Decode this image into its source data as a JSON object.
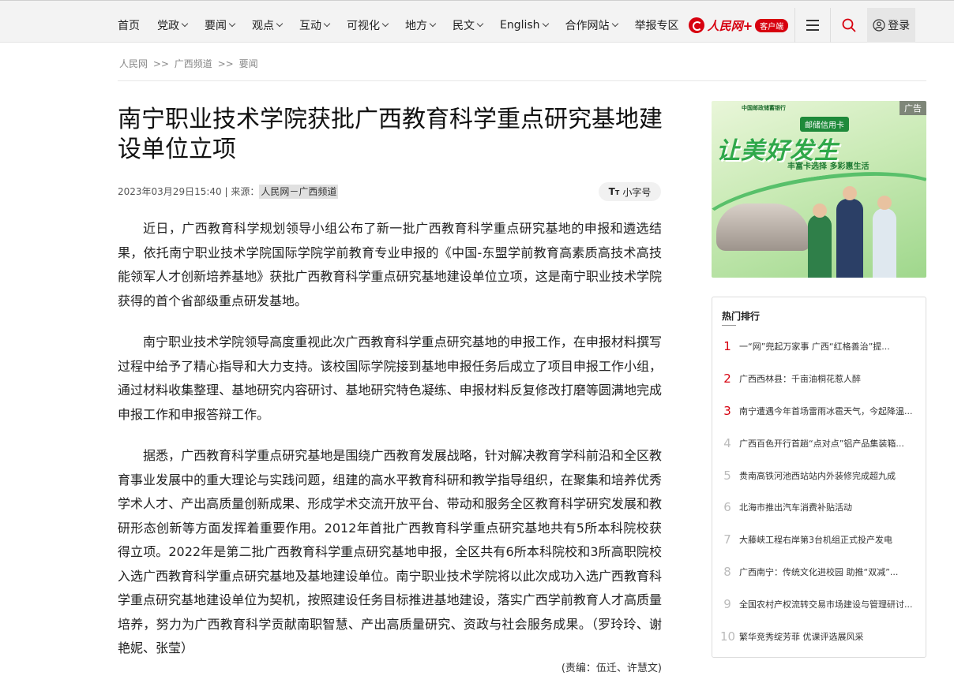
{
  "nav": {
    "items": [
      {
        "label": "首页",
        "dropdown": false
      },
      {
        "label": "党政",
        "dropdown": true
      },
      {
        "label": "要闻",
        "dropdown": true
      },
      {
        "label": "观点",
        "dropdown": true
      },
      {
        "label": "互动",
        "dropdown": true
      },
      {
        "label": "可视化",
        "dropdown": true
      },
      {
        "label": "地方",
        "dropdown": true
      },
      {
        "label": "民文",
        "dropdown": true
      },
      {
        "label": "English",
        "dropdown": true
      },
      {
        "label": "合作网站",
        "dropdown": true
      },
      {
        "label": "举报专区",
        "dropdown": false
      }
    ],
    "logo_text": "人民网+",
    "logo_badge": "客户端",
    "login_label": "登录"
  },
  "breadcrumb": {
    "items": [
      "人民网",
      "广西频道",
      "要闻"
    ],
    "separator": ">>"
  },
  "article": {
    "title": "南宁职业技术学院获批广西教育科学重点研究基地建设单位立项",
    "date": "2023年03月29日15:40",
    "source_prefix": " | 来源：",
    "source": "人民网－广西频道",
    "font_size_label": "小字号",
    "paragraphs": [
      "近日，广西教育科学规划领导小组公布了新一批广西教育科学重点研究基地的申报和遴选结果，依托南宁职业技术学院国际学院学前教育专业申报的《中国-东盟学前教育高素质高技术高技能领军人才创新培养基地》获批广西教育科学重点研究基地建设单位立项，这是南宁职业技术学院获得的首个省部级重点研发基地。",
      "南宁职业技术学院领导高度重视此次广西教育科学重点研究基地的申报工作，在申报材料撰写过程中给予了精心指导和大力支持。该校国际学院接到基地申报任务后成立了项目申报工作小组，通过材料收集整理、基地研究内容研讨、基地研究特色凝练、申报材料反复修改打磨等圆满地完成申报工作和申报答辩工作。",
      "据悉，广西教育科学重点研究基地是围绕广西教育发展战略，针对解决教育学科前沿和全区教育事业发展中的重大理论与实践问题，组建的高水平教育科研和教学指导组织，在聚集和培养优秀学术人才、产出高质量创新成果、形成学术交流开放平台、带动和服务全区教育科学研究发展和教研形态创新等方面发挥着重要作用。2012年首批广西教育科学重点研究基地共有5所本科院校获得立项。2022年是第二批广西教育科学重点研究基地申报，全区共有6所本科院校和3所高职院校入选广西教育科学重点研究基地及基地建设单位。南宁职业技术学院将以此次成功入选广西教育科学重点研究基地建设单位为契机，按照建设任务目标推进基地建设，落实广西学前教育人才高质量培养，努力为广西教育科学贡献南职智慧、产出高质量研究、资政与社会服务成果。（罗玲玲、谢艳妮、张莹）"
    ],
    "editor": "(责编：伍迁、许慧文)"
  },
  "ad": {
    "tag": "广告",
    "bank": "中国邮政储蓄银行",
    "subtitle": "邮储信用卡",
    "slogan": "让美好发生",
    "tagline": "丰富卡选择 多彩惠生活"
  },
  "ranking": {
    "title": "热门排行",
    "items": [
      {
        "rank": "1",
        "text": "一“网”兜起万家事 广西“红格善治”提..."
      },
      {
        "rank": "2",
        "text": "广西西林县：千亩油桐花惹人醉"
      },
      {
        "rank": "3",
        "text": "南宁遭遇今年首场雷雨冰雹天气，今起降温..."
      },
      {
        "rank": "4",
        "text": "广西百色开行首趟“点对点”铝产品集装箱..."
      },
      {
        "rank": "5",
        "text": "贵南高铁河池西站站内外装修完成超九成"
      },
      {
        "rank": "6",
        "text": "北海市推出汽车消费补贴活动"
      },
      {
        "rank": "7",
        "text": "大藤峡工程右岸第3台机组正式投产发电"
      },
      {
        "rank": "8",
        "text": "广西南宁：传统文化进校园 助推“双减”..."
      },
      {
        "rank": "9",
        "text": "全国农村产权流转交易市场建设与管理研讨..."
      },
      {
        "rank": "10",
        "text": "繁华竞秀绽芳菲 优课评选展风采"
      }
    ]
  },
  "colors": {
    "brand_red": "#d7000f",
    "rank_inactive": "#bbbbbb",
    "nav_bg": "#f3f3f3"
  }
}
